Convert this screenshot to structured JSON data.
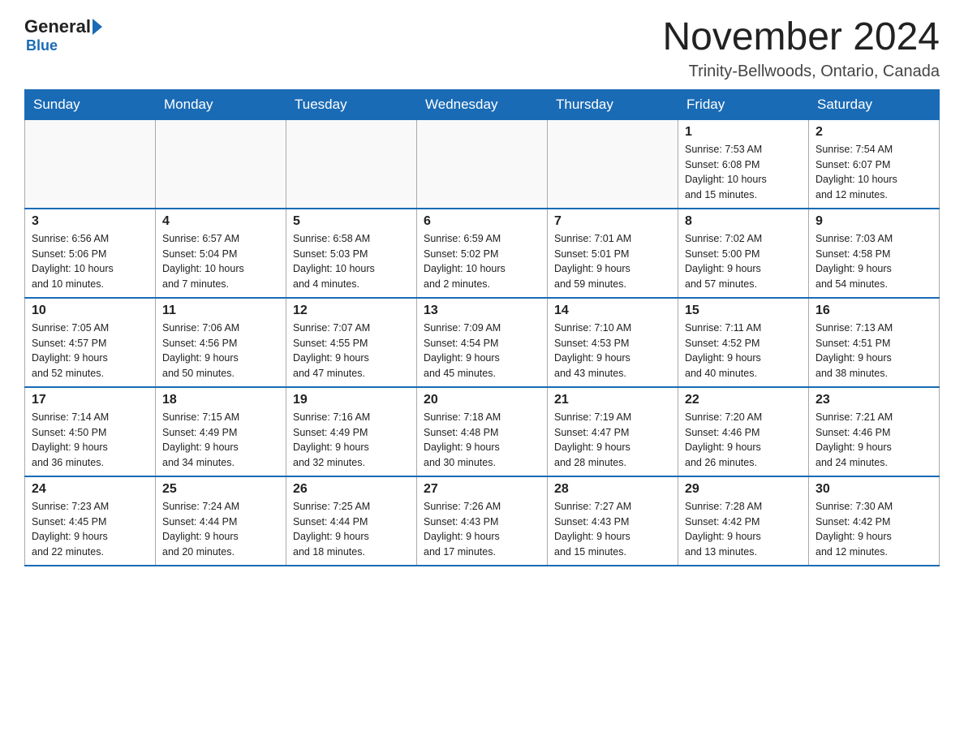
{
  "header": {
    "logo_general": "General",
    "logo_blue": "Blue",
    "month_title": "November 2024",
    "location": "Trinity-Bellwoods, Ontario, Canada"
  },
  "days_of_week": [
    "Sunday",
    "Monday",
    "Tuesday",
    "Wednesday",
    "Thursday",
    "Friday",
    "Saturday"
  ],
  "weeks": [
    [
      {
        "day": "",
        "info": ""
      },
      {
        "day": "",
        "info": ""
      },
      {
        "day": "",
        "info": ""
      },
      {
        "day": "",
        "info": ""
      },
      {
        "day": "",
        "info": ""
      },
      {
        "day": "1",
        "info": "Sunrise: 7:53 AM\nSunset: 6:08 PM\nDaylight: 10 hours\nand 15 minutes."
      },
      {
        "day": "2",
        "info": "Sunrise: 7:54 AM\nSunset: 6:07 PM\nDaylight: 10 hours\nand 12 minutes."
      }
    ],
    [
      {
        "day": "3",
        "info": "Sunrise: 6:56 AM\nSunset: 5:06 PM\nDaylight: 10 hours\nand 10 minutes."
      },
      {
        "day": "4",
        "info": "Sunrise: 6:57 AM\nSunset: 5:04 PM\nDaylight: 10 hours\nand 7 minutes."
      },
      {
        "day": "5",
        "info": "Sunrise: 6:58 AM\nSunset: 5:03 PM\nDaylight: 10 hours\nand 4 minutes."
      },
      {
        "day": "6",
        "info": "Sunrise: 6:59 AM\nSunset: 5:02 PM\nDaylight: 10 hours\nand 2 minutes."
      },
      {
        "day": "7",
        "info": "Sunrise: 7:01 AM\nSunset: 5:01 PM\nDaylight: 9 hours\nand 59 minutes."
      },
      {
        "day": "8",
        "info": "Sunrise: 7:02 AM\nSunset: 5:00 PM\nDaylight: 9 hours\nand 57 minutes."
      },
      {
        "day": "9",
        "info": "Sunrise: 7:03 AM\nSunset: 4:58 PM\nDaylight: 9 hours\nand 54 minutes."
      }
    ],
    [
      {
        "day": "10",
        "info": "Sunrise: 7:05 AM\nSunset: 4:57 PM\nDaylight: 9 hours\nand 52 minutes."
      },
      {
        "day": "11",
        "info": "Sunrise: 7:06 AM\nSunset: 4:56 PM\nDaylight: 9 hours\nand 50 minutes."
      },
      {
        "day": "12",
        "info": "Sunrise: 7:07 AM\nSunset: 4:55 PM\nDaylight: 9 hours\nand 47 minutes."
      },
      {
        "day": "13",
        "info": "Sunrise: 7:09 AM\nSunset: 4:54 PM\nDaylight: 9 hours\nand 45 minutes."
      },
      {
        "day": "14",
        "info": "Sunrise: 7:10 AM\nSunset: 4:53 PM\nDaylight: 9 hours\nand 43 minutes."
      },
      {
        "day": "15",
        "info": "Sunrise: 7:11 AM\nSunset: 4:52 PM\nDaylight: 9 hours\nand 40 minutes."
      },
      {
        "day": "16",
        "info": "Sunrise: 7:13 AM\nSunset: 4:51 PM\nDaylight: 9 hours\nand 38 minutes."
      }
    ],
    [
      {
        "day": "17",
        "info": "Sunrise: 7:14 AM\nSunset: 4:50 PM\nDaylight: 9 hours\nand 36 minutes."
      },
      {
        "day": "18",
        "info": "Sunrise: 7:15 AM\nSunset: 4:49 PM\nDaylight: 9 hours\nand 34 minutes."
      },
      {
        "day": "19",
        "info": "Sunrise: 7:16 AM\nSunset: 4:49 PM\nDaylight: 9 hours\nand 32 minutes."
      },
      {
        "day": "20",
        "info": "Sunrise: 7:18 AM\nSunset: 4:48 PM\nDaylight: 9 hours\nand 30 minutes."
      },
      {
        "day": "21",
        "info": "Sunrise: 7:19 AM\nSunset: 4:47 PM\nDaylight: 9 hours\nand 28 minutes."
      },
      {
        "day": "22",
        "info": "Sunrise: 7:20 AM\nSunset: 4:46 PM\nDaylight: 9 hours\nand 26 minutes."
      },
      {
        "day": "23",
        "info": "Sunrise: 7:21 AM\nSunset: 4:46 PM\nDaylight: 9 hours\nand 24 minutes."
      }
    ],
    [
      {
        "day": "24",
        "info": "Sunrise: 7:23 AM\nSunset: 4:45 PM\nDaylight: 9 hours\nand 22 minutes."
      },
      {
        "day": "25",
        "info": "Sunrise: 7:24 AM\nSunset: 4:44 PM\nDaylight: 9 hours\nand 20 minutes."
      },
      {
        "day": "26",
        "info": "Sunrise: 7:25 AM\nSunset: 4:44 PM\nDaylight: 9 hours\nand 18 minutes."
      },
      {
        "day": "27",
        "info": "Sunrise: 7:26 AM\nSunset: 4:43 PM\nDaylight: 9 hours\nand 17 minutes."
      },
      {
        "day": "28",
        "info": "Sunrise: 7:27 AM\nSunset: 4:43 PM\nDaylight: 9 hours\nand 15 minutes."
      },
      {
        "day": "29",
        "info": "Sunrise: 7:28 AM\nSunset: 4:42 PM\nDaylight: 9 hours\nand 13 minutes."
      },
      {
        "day": "30",
        "info": "Sunrise: 7:30 AM\nSunset: 4:42 PM\nDaylight: 9 hours\nand 12 minutes."
      }
    ]
  ]
}
